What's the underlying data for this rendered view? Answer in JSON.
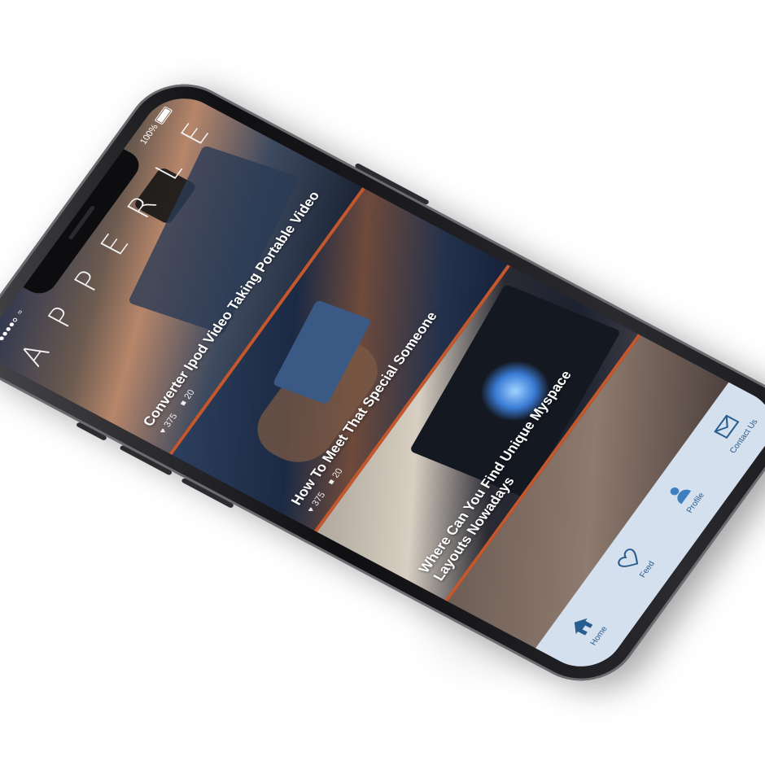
{
  "status_bar": {
    "signal_dots": 5,
    "carrier_icon": "wifi-icon",
    "battery_text": "100%"
  },
  "header": {
    "logo_text": "A P P E R L E"
  },
  "feed": {
    "cards": [
      {
        "title": "Converter Ipod Video Taking Portable Video",
        "likes": "375",
        "comments": "20"
      },
      {
        "title": "How To Meet That Special Someone",
        "likes": "375",
        "comments": "20"
      },
      {
        "title": "Where Can You Find Unique Myspace Layouts Nowadays"
      }
    ]
  },
  "tab_bar": {
    "tabs": [
      {
        "label": "Home",
        "icon": "home-icon",
        "active": true
      },
      {
        "label": "Feed",
        "icon": "heart-icon",
        "active": false
      },
      {
        "label": "Profile",
        "icon": "user-icon",
        "active": false
      },
      {
        "label": "Contact Us",
        "icon": "envelope-icon",
        "active": false
      }
    ]
  },
  "colors": {
    "accent": "#c4572c",
    "tab_bar_bg": "#d4e0ee",
    "tab_active": "#2a5d8f",
    "screen_bg": "#1e2b44"
  }
}
